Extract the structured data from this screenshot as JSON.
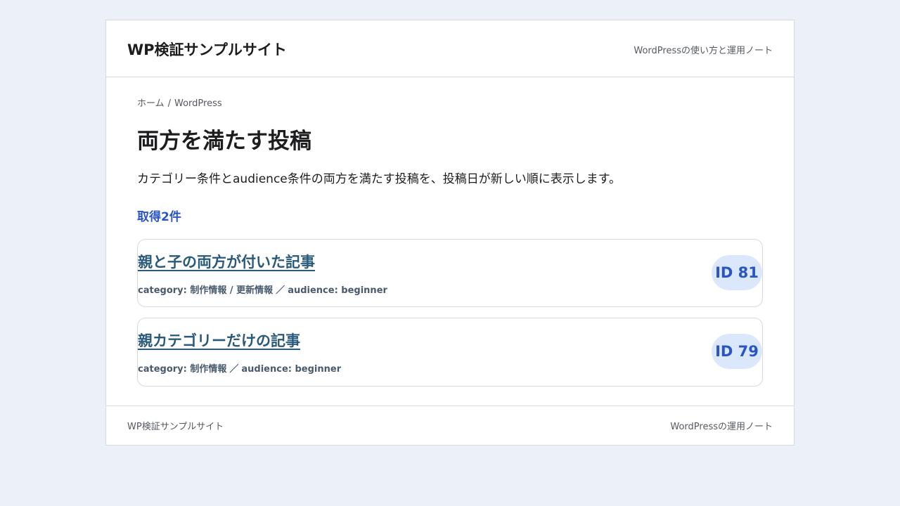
{
  "header": {
    "site_title": "WP検証サンプルサイト",
    "tagline": "WordPressの使い方と運用ノート"
  },
  "breadcrumb": {
    "home": "ホーム",
    "separator": "/",
    "current": "WordPress"
  },
  "main": {
    "title": "両方を満たす投稿",
    "description": "カテゴリー条件とaudience条件の両方を満たす投稿を、投稿日が新しい順に表示します。",
    "result_count": "取得2件",
    "posts": [
      {
        "title": "親と子の両方が付いた記事",
        "category": "category: 制作情報 / 更新情報",
        "separator": "／",
        "audience": "audience: beginner",
        "id_label": "ID 81"
      },
      {
        "title": "親カテゴリーだけの記事",
        "category": "category: 制作情報",
        "separator": "／",
        "audience": "audience: beginner",
        "id_label": "ID 79"
      }
    ]
  },
  "footer": {
    "left": "WP検証サンプルサイト",
    "right": "WordPressの運用ノート"
  },
  "colors": {
    "page_background": "#ecf1f9",
    "accent_blue": "#2a55c8",
    "post_link": "#2a5a7a",
    "badge_background": "#dbe7fb"
  }
}
